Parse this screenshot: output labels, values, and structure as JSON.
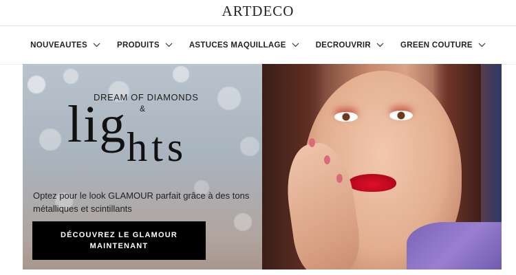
{
  "header": {
    "logo": "ARTDECO"
  },
  "nav": {
    "items": [
      {
        "label": "NOUVEAUTES"
      },
      {
        "label": "PRODUITS"
      },
      {
        "label": "ASTUCES MAQUILLAGE"
      },
      {
        "label": "DECROUVRIR"
      },
      {
        "label": "GREEN COUTURE"
      }
    ]
  },
  "hero": {
    "subtitle": "DREAM OF DIAMONDS",
    "ampersand": "&",
    "big_word_top": "lig",
    "big_word_bottom": "hts",
    "description": "Optez pour le look GLAMOUR parfait grâce à des tons métalliques et scintillants",
    "cta_label": "DÉCOUVREZ LE GLAMOUR MAINTENANT"
  },
  "colors": {
    "cta_bg": "#000000",
    "text": "#222222",
    "lips": "#e10f2a",
    "sweater": "#8a70c4"
  }
}
